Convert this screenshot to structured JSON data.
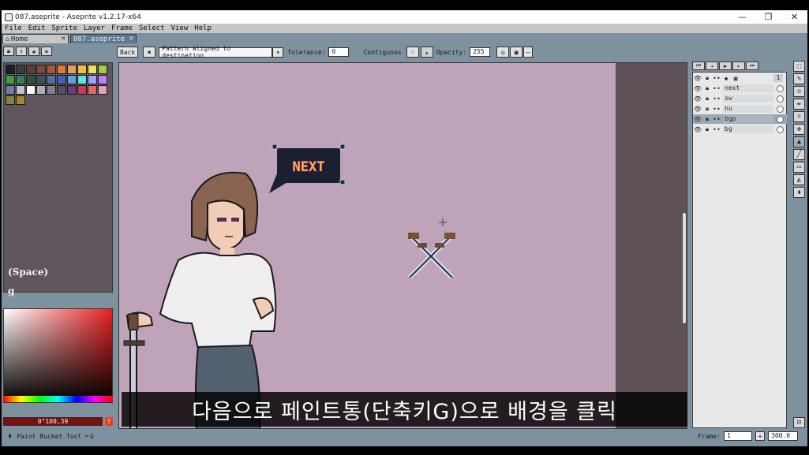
{
  "window": {
    "title": "087.aseprite - Aseprite v1.2.17-x64",
    "controls": [
      "—",
      "❐",
      "✕"
    ]
  },
  "menu": [
    "File",
    "Edit",
    "Sprite",
    "Layer",
    "Frame",
    "Select",
    "View",
    "Help"
  ],
  "tabs": [
    {
      "label": "Home",
      "close": "✕",
      "icon": "home-icon"
    },
    {
      "label": "087.aseprite",
      "close": "✕"
    }
  ],
  "palette_colors": [
    "#1c1c24",
    "#3c3c48",
    "#5a4040",
    "#7c4a3a",
    "#a05a3a",
    "#e07a30",
    "#e8a060",
    "#f0c040",
    "#f0e060",
    "#a0d040",
    "#40a040",
    "#308060",
    "#305040",
    "#405060",
    "#5070a0",
    "#4060c0",
    "#60a0e0",
    "#60e0e0",
    "#a0a0ff",
    "#c080ff",
    "#7080a0",
    "#c0c0d0",
    "#f8f8f8",
    "#b0b0b0",
    "#808090",
    "#505060",
    "#6a3a7a",
    "#c03a5a",
    "#e06a6a",
    "#e0a0c0",
    "#8a8040",
    "#a08a30"
  ],
  "left_panel": {
    "hint_space": "(Space)",
    "hint_key": "g",
    "fg_color": "0°100,39",
    "bg_color": "205°68,14",
    "warn": "!"
  },
  "context_bar": {
    "back_label": "Back",
    "pattern_value": "Pattern aligned to destination",
    "tolerance_label": "Tolerance:",
    "tolerance_value": "0",
    "contiguous_label": "Contiguous",
    "opacity_label": "Opacity:",
    "opacity_value": "255"
  },
  "canvas": {
    "speech_text": "NEXT",
    "subtitle": "다음으로 페인트통(단축키G)으로 배경을 클릭"
  },
  "layers": [
    {
      "name": "",
      "selected": false
    },
    {
      "name": "next",
      "selected": false
    },
    {
      "name": "sw",
      "selected": false
    },
    {
      "name": "hu",
      "selected": false
    },
    {
      "name": "bgp",
      "selected": true
    },
    {
      "name": "bg",
      "selected": false
    }
  ],
  "frame_header": "1",
  "status": {
    "tool_text": "Paint Bucket Tool",
    "shortcut": "G",
    "frame_label": "Frame:",
    "frame_value": "1",
    "zoom_value": "300.0"
  }
}
